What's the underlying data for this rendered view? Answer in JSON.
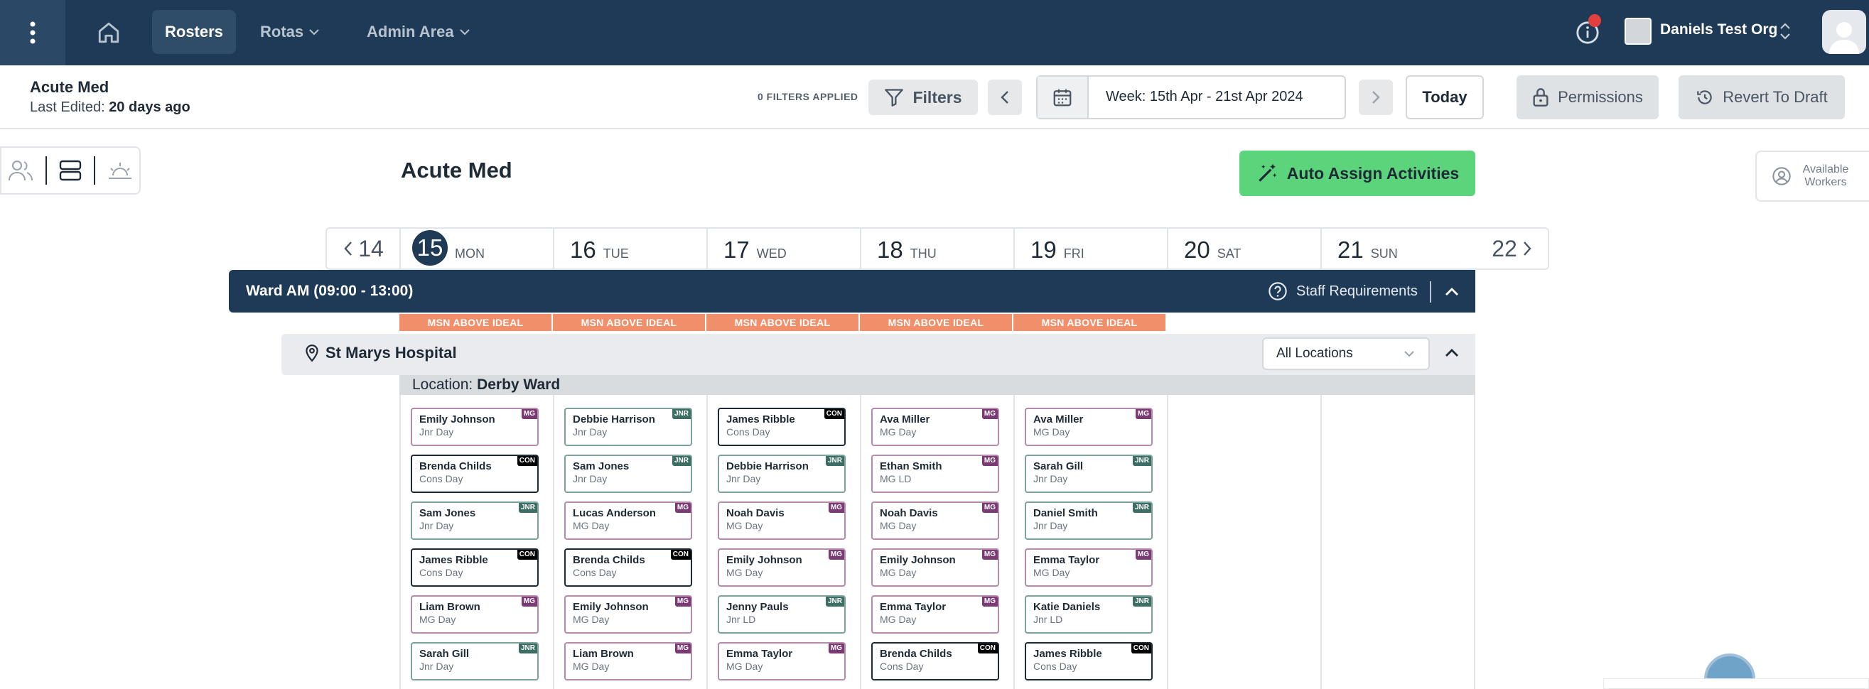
{
  "nav": {
    "rosters": "Rosters",
    "rotas": "Rotas",
    "admin": "Admin Area",
    "org_name": "Daniels Test Org"
  },
  "header": {
    "title": "Acute Med",
    "last_edited_label": "Last Edited:",
    "last_edited_value": "20 days ago",
    "filters_applied": "0 FILTERS APPLIED",
    "filters_label": "Filters",
    "week": "Week: 15th Apr - 21st Apr 2024",
    "today": "Today",
    "permissions": "Permissions",
    "revert": "Revert To Draft"
  },
  "page": {
    "title": "Acute Med",
    "auto_assign": "Auto Assign Activities",
    "available_workers": "Available Workers"
  },
  "days": {
    "prev": "14",
    "next": "22",
    "list": [
      {
        "num": "15",
        "name": "MON"
      },
      {
        "num": "16",
        "name": "TUE"
      },
      {
        "num": "17",
        "name": "WED"
      },
      {
        "num": "18",
        "name": "THU"
      },
      {
        "num": "19",
        "name": "FRI"
      },
      {
        "num": "20",
        "name": "SAT"
      },
      {
        "num": "21",
        "name": "SUN"
      }
    ]
  },
  "shift": {
    "name": "Ward AM (09:00 - 13:00)",
    "staff_requirements": "Staff Requirements",
    "msn": [
      "MSN ABOVE IDEAL",
      "MSN ABOVE IDEAL",
      "MSN ABOVE IDEAL",
      "MSN ABOVE IDEAL",
      "MSN ABOVE IDEAL"
    ]
  },
  "hospital": {
    "name": "St Marys Hospital",
    "location_filter": "All Locations",
    "location_label": "Location:",
    "location_value": "Derby Ward"
  },
  "columns": [
    [
      {
        "name": "Emily Johnson",
        "role": "Jnr Day",
        "badge": "MG"
      },
      {
        "name": "Brenda Childs",
        "role": "Cons Day",
        "badge": "CON"
      },
      {
        "name": "Sam Jones",
        "role": "Jnr Day",
        "badge": "JNR"
      },
      {
        "name": "James Ribble",
        "role": "Cons Day",
        "badge": "CON"
      },
      {
        "name": "Liam Brown",
        "role": "MG Day",
        "badge": "MG"
      },
      {
        "name": "Sarah Gill",
        "role": "Jnr Day",
        "badge": "JNR"
      }
    ],
    [
      {
        "name": "Debbie Harrison",
        "role": "Jnr Day",
        "badge": "JNR"
      },
      {
        "name": "Sam Jones",
        "role": "Jnr Day",
        "badge": "JNR"
      },
      {
        "name": "Lucas Anderson",
        "role": "MG Day",
        "badge": "MG"
      },
      {
        "name": "Brenda Childs",
        "role": "Cons Day",
        "badge": "CON"
      },
      {
        "name": "Emily Johnson",
        "role": "MG Day",
        "badge": "MG"
      },
      {
        "name": "Liam Brown",
        "role": "MG Day",
        "badge": "MG"
      }
    ],
    [
      {
        "name": "James Ribble",
        "role": "Cons Day",
        "badge": "CON"
      },
      {
        "name": "Debbie Harrison",
        "role": "Jnr Day",
        "badge": "JNR"
      },
      {
        "name": "Noah Davis",
        "role": "MG Day",
        "badge": "MG"
      },
      {
        "name": "Emily Johnson",
        "role": "MG Day",
        "badge": "MG"
      },
      {
        "name": "Jenny Pauls",
        "role": "Jnr LD",
        "badge": "JNR"
      },
      {
        "name": "Emma Taylor",
        "role": "MG Day",
        "badge": "MG"
      }
    ],
    [
      {
        "name": "Ava Miller",
        "role": "MG Day",
        "badge": "MG"
      },
      {
        "name": "Ethan Smith",
        "role": "MG LD",
        "badge": "MG"
      },
      {
        "name": "Noah Davis",
        "role": "MG Day",
        "badge": "MG"
      },
      {
        "name": "Emily Johnson",
        "role": "MG Day",
        "badge": "MG"
      },
      {
        "name": "Emma Taylor",
        "role": "MG Day",
        "badge": "MG"
      },
      {
        "name": "Brenda Childs",
        "role": "Cons Day",
        "badge": "CON"
      }
    ],
    [
      {
        "name": "Ava Miller",
        "role": "MG Day",
        "badge": "MG"
      },
      {
        "name": "Sarah Gill",
        "role": "Jnr Day",
        "badge": "JNR"
      },
      {
        "name": "Daniel Smith",
        "role": "Jnr Day",
        "badge": "JNR"
      },
      {
        "name": "Emma Taylor",
        "role": "MG Day",
        "badge": "MG"
      },
      {
        "name": "Katie Daniels",
        "role": "Jnr LD",
        "badge": "JNR"
      },
      {
        "name": "James Ribble",
        "role": "Cons Day",
        "badge": "CON"
      }
    ]
  ],
  "colors": {
    "navy": "#1e3a56",
    "auto_assign_green": "#5cd47c",
    "msn_orange": "#f08f69",
    "badge_mg": "#7a3a74",
    "badge_jnr": "#3d6e66",
    "badge_con": "#000000"
  }
}
